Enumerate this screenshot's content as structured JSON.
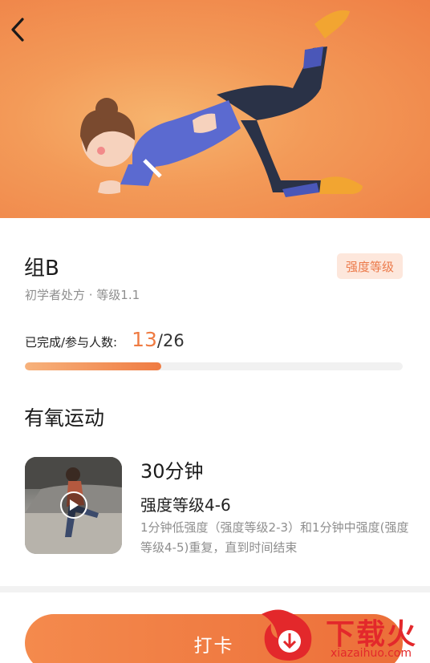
{
  "header": {
    "back_icon": "chevron-left-icon"
  },
  "plan": {
    "title": "组B",
    "subtitle": "初学者处方 · 等级1.1",
    "badge": "强度等级"
  },
  "progress": {
    "label": "已完成/参与人数:",
    "done": "13",
    "slash": "/",
    "total": "26",
    "fraction": 0.36
  },
  "section": {
    "title": "有氧运动"
  },
  "exercise": {
    "duration": "30分钟",
    "level": "强度等级4-6",
    "description": "1分钟低强度（强度等级2-3）和1分钟中强度(强度等级4-5)重复，直到时间结束",
    "play_icon": "play-icon"
  },
  "action": {
    "checkin_label": "打卡"
  },
  "watermark": {
    "text": "下载火",
    "sub": "xiazaihuo.com"
  },
  "colors": {
    "accent": "#ef7b42",
    "badge_bg": "#fde7dc",
    "watermark": "#e3282b"
  }
}
